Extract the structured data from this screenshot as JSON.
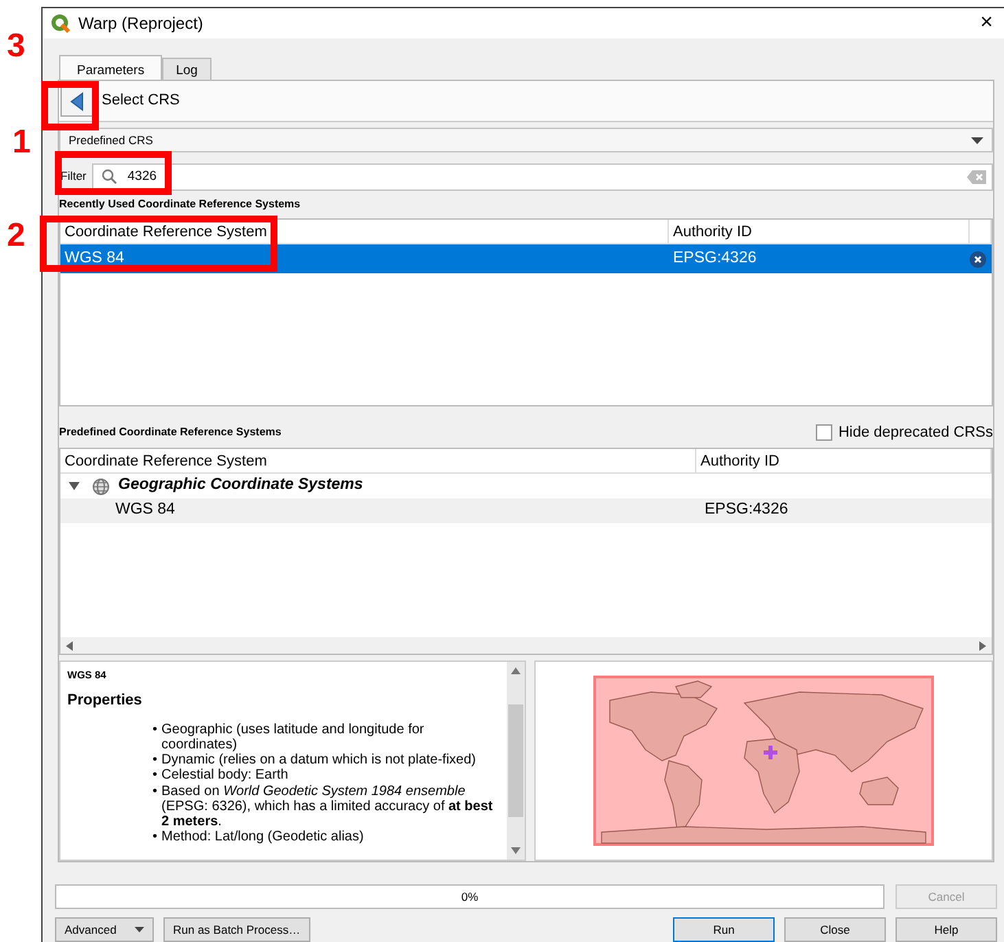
{
  "annotations": [
    {
      "label": "3"
    },
    {
      "label": "1"
    },
    {
      "label": "2"
    }
  ],
  "window": {
    "title": "Warp (Reproject)",
    "close": "×"
  },
  "tabs": [
    {
      "label": "Parameters",
      "selected": true
    },
    {
      "label": "Log",
      "selected": false
    }
  ],
  "crs_panel": {
    "title": "Select CRS",
    "mode": "Predefined CRS",
    "filter": {
      "label": "Filter",
      "value": "4326"
    },
    "recent": {
      "title": "Recently Used Coordinate Reference Systems",
      "columns": [
        "Coordinate Reference System",
        "Authority ID"
      ],
      "rows": [
        {
          "crs": "WGS 84",
          "authority_id": "EPSG:4326",
          "selected": true
        }
      ]
    },
    "predefined": {
      "title": "Predefined Coordinate Reference Systems",
      "hide_deprecated": {
        "label": "Hide deprecated CRSs",
        "checked": false
      },
      "columns": [
        "Coordinate Reference System",
        "Authority ID"
      ],
      "groups": [
        {
          "name": "Geographic Coordinate Systems",
          "expanded": true,
          "children": [
            {
              "crs": "WGS 84",
              "authority_id": "EPSG:4326"
            }
          ]
        }
      ]
    },
    "details": {
      "name": "WGS 84",
      "heading": "Properties",
      "items": [
        {
          "marker": "•",
          "text": "Geographic (uses latitude and longitude for coordinates)"
        },
        {
          "marker": "•",
          "text": "Dynamic (relies on a datum which is not plate-fixed)"
        },
        {
          "marker": "•",
          "text": "Celestial body: Earth"
        },
        {
          "marker": "•",
          "text": "Based on *World Geodetic System 1984 ensemble* (EPSG: 6326), which has a limited accuracy of **at best 2 meters**."
        },
        {
          "marker": "•",
          "text": "Method: Lat/long (Geodetic alias)"
        }
      ]
    }
  },
  "progress": {
    "level": 0,
    "label": "0%"
  },
  "cancel_button": {
    "label": "Cancel",
    "disabled": true
  },
  "buttons": [
    {
      "label": "Advanced",
      "kind": "dropdown"
    },
    {
      "label": "Run as Batch Process…",
      "kind": "plain"
    },
    {
      "label": "Run",
      "kind": "default"
    },
    {
      "label": "Close",
      "kind": "plain"
    },
    {
      "label": "Help",
      "kind": "plain"
    }
  ]
}
